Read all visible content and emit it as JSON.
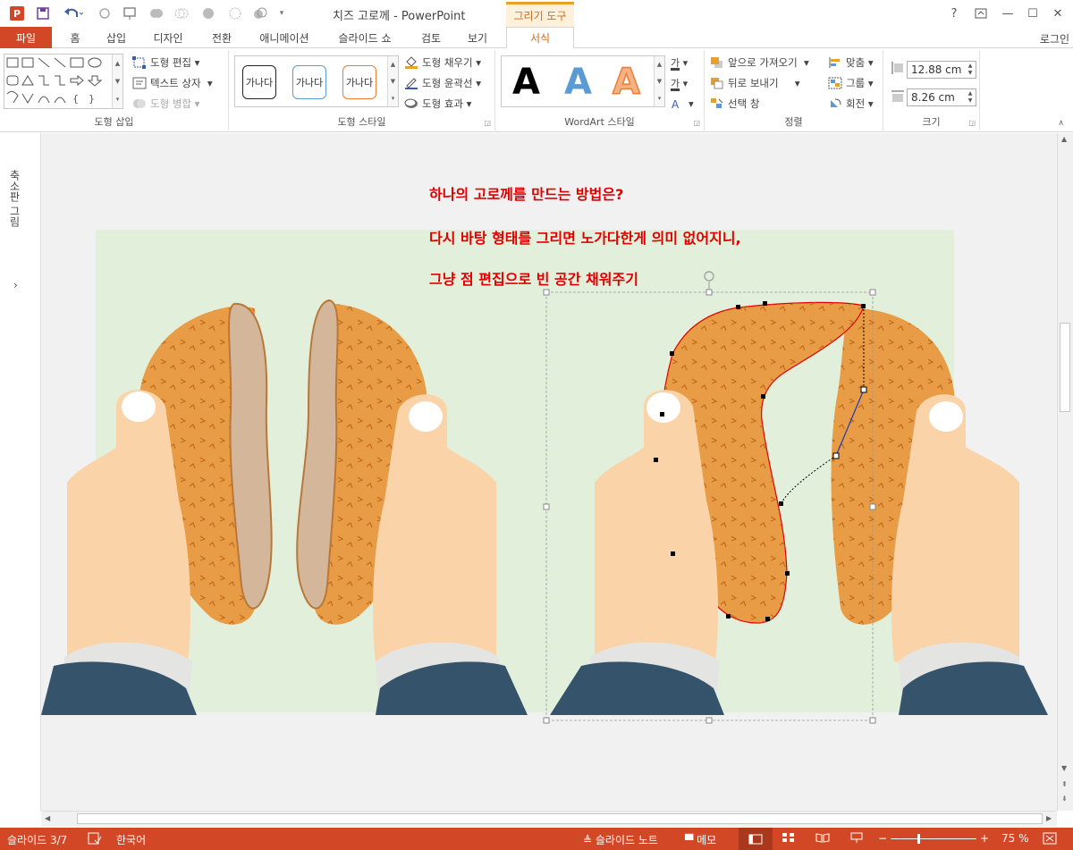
{
  "window": {
    "title": "치즈 고로께 - PowerPoint",
    "context_tab": "그리기 도구",
    "controls": {
      "help": "?",
      "ribbon_opts": "⧉",
      "minimize": "—",
      "maximize": "☐",
      "close": "✕"
    }
  },
  "tabs": [
    "파일",
    "홈",
    "삽입",
    "디자인",
    "전환",
    "애니메이션",
    "슬라이드 쇼",
    "검토",
    "보기",
    "서식"
  ],
  "active_tab": "서식",
  "login": "로그인",
  "ribbon": {
    "insert_shapes": {
      "label": "도형 삽입",
      "edit_shape": "도형 편집",
      "text_box": "텍스트 상자",
      "merge_shapes": "도형 병합"
    },
    "shape_styles": {
      "label": "도형 스타일",
      "swatch_text": "가나다",
      "fill": "도형 채우기",
      "outline": "도형 윤곽선",
      "effects": "도형 효과"
    },
    "wordart": {
      "label": "WordArt 스타일",
      "letter": "A",
      "text_fill_glyph": "가",
      "text_outline_glyph": "가"
    },
    "arrange": {
      "label": "정렬",
      "bring_forward": "앞으로 가져오기",
      "send_backward": "뒤로 보내기",
      "selection_pane": "선택 창",
      "align": "맞춤",
      "group": "그룹",
      "rotate": "회전"
    },
    "size": {
      "label": "크기",
      "height": "12.88 cm",
      "width": "8.26 cm"
    }
  },
  "thumb_pane_label": "축소판 그림",
  "slide": {
    "line1": "하나의 고로께를 만드는 방법은?",
    "line2": "다시 바탕 형태를 그리면 노가다한게 의미 없어지니,",
    "line3": "그냥 점 편집으로 빈 공간 채워주기",
    "colors": {
      "background": "#e2efda",
      "croquette": "#e89c45",
      "croquette_inner": "#d4b79a",
      "skin": "#fbd3a9",
      "nail": "#ffffff",
      "cuff": "#e4e4e2",
      "sleeve": "#35536b",
      "path_outline": "#e00000"
    }
  },
  "status": {
    "slide_counter": "슬라이드 3/7",
    "language": "한국어",
    "notes": "슬라이드 노트",
    "comments": "메모",
    "zoom": "75 %",
    "zoom_minus": "−",
    "zoom_plus": "+"
  }
}
